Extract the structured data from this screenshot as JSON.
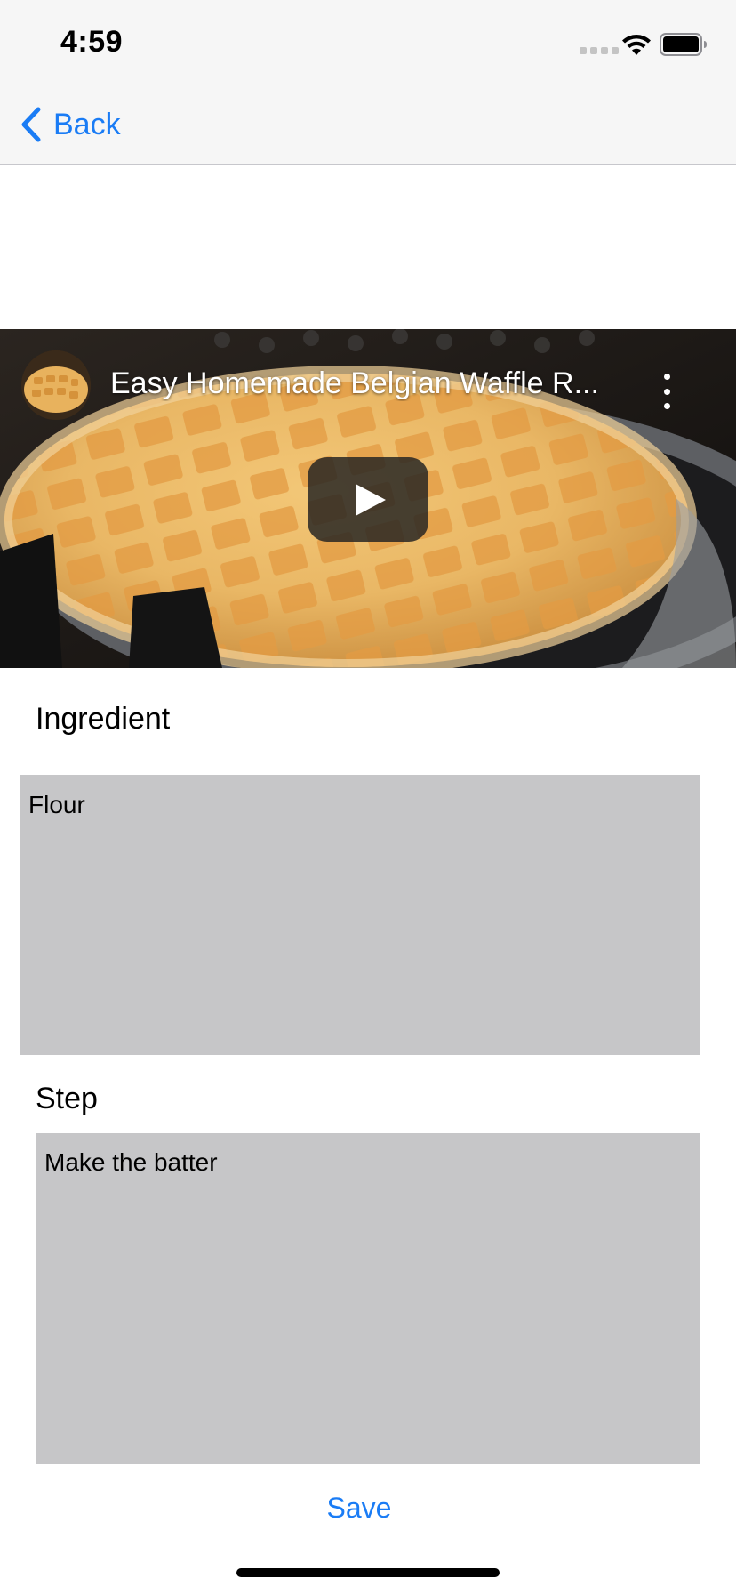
{
  "status_bar": {
    "time": "4:59"
  },
  "nav": {
    "back_label": "Back"
  },
  "video": {
    "title": "Easy Homemade Belgian Waffle R...",
    "icons": {
      "play": "play-icon",
      "menu": "more-vertical-icon"
    }
  },
  "form": {
    "ingredient_label": "Ingredient",
    "ingredient_value": "Flour",
    "step_label": "Step",
    "step_value": "Make the batter",
    "save_label": "Save"
  },
  "colors": {
    "accent": "#1a7cf5",
    "nav_background": "#f6f6f6",
    "field_background": "#c6c6c8"
  }
}
